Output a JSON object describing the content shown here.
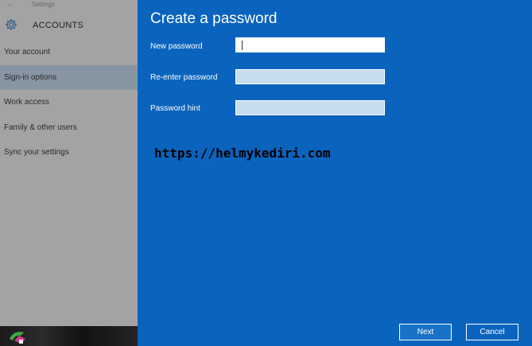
{
  "settings": {
    "app_title": "Settings",
    "back_glyph": "←",
    "section_title": "ACCOUNTS",
    "section_icon": "gear-icon",
    "nav_items": [
      {
        "label": "Your account"
      },
      {
        "label": "Sign-in options",
        "active": true
      },
      {
        "label": "Work access"
      },
      {
        "label": "Family & other users"
      },
      {
        "label": "Sync your settings"
      }
    ]
  },
  "dialog": {
    "title": "Create a password",
    "fields": [
      {
        "label": "New password",
        "value": ""
      },
      {
        "label": "Re-enter password",
        "value": ""
      },
      {
        "label": "Password hint",
        "value": ""
      }
    ],
    "watermark": "https://helmykediri.com",
    "next_label": "Next",
    "cancel_label": "Cancel"
  },
  "colors": {
    "dialog_background": "#0a64be",
    "settings_background": "#a3a3a3",
    "active_nav": "#8795a3"
  }
}
